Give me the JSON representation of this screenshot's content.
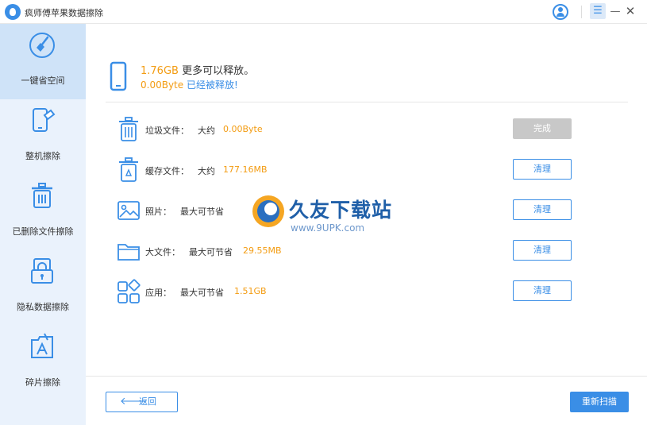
{
  "window": {
    "title": "疯师傅苹果数据擦除",
    "menu_glyph": "☰",
    "minimize_glyph": "—",
    "close_glyph": "✕"
  },
  "sidebar": {
    "items": [
      {
        "label": "一键省空间",
        "icon": "broom-icon",
        "active": true
      },
      {
        "label": "整机擦除",
        "icon": "phone-eraser-icon",
        "active": false
      },
      {
        "label": "已删除文件擦除",
        "icon": "trash-bin-icon",
        "active": false
      },
      {
        "label": "隐私数据擦除",
        "icon": "lock-icon",
        "active": false
      },
      {
        "label": "碎片擦除",
        "icon": "fragment-file-icon",
        "active": false
      }
    ]
  },
  "summary": {
    "releasable_amount": "1.76GB",
    "releasable_text": " 更多可以释放。",
    "released_amount": "0.00Byte",
    "released_text": " 已经被释放!"
  },
  "rows": [
    {
      "label": "垃圾文件：",
      "prefix": "大约",
      "value": "0.00Byte",
      "button": "完成",
      "icon": "trash-can-icon",
      "done": true
    },
    {
      "label": "缓存文件：",
      "prefix": "大约",
      "value": "177.16MB",
      "button": "清理",
      "icon": "recycle-bin-icon",
      "done": false
    },
    {
      "label": "照片：",
      "prefix": "最大可节省",
      "value": "",
      "button": "清理",
      "icon": "image-icon",
      "done": false
    },
    {
      "label": "大文件：",
      "prefix": "最大可节省",
      "value": "29.55MB",
      "button": "清理",
      "icon": "folder-icon",
      "done": false
    },
    {
      "label": "应用：",
      "prefix": "最大可节省",
      "value": "1.51GB",
      "button": "清理",
      "icon": "apps-grid-icon",
      "done": false
    }
  ],
  "watermark": {
    "text": "久友下载站",
    "url": "www.9UPK.com"
  },
  "footer": {
    "back_label": "返回",
    "back_arrow": "🡐",
    "rescan_label": "重新扫描"
  },
  "colors": {
    "accent": "#3a8ee6",
    "highlight": "#f39c12",
    "sidebar_bg": "#eaf2fc",
    "sidebar_active": "#cfe3f8",
    "done_button": "#c8c8c8"
  }
}
